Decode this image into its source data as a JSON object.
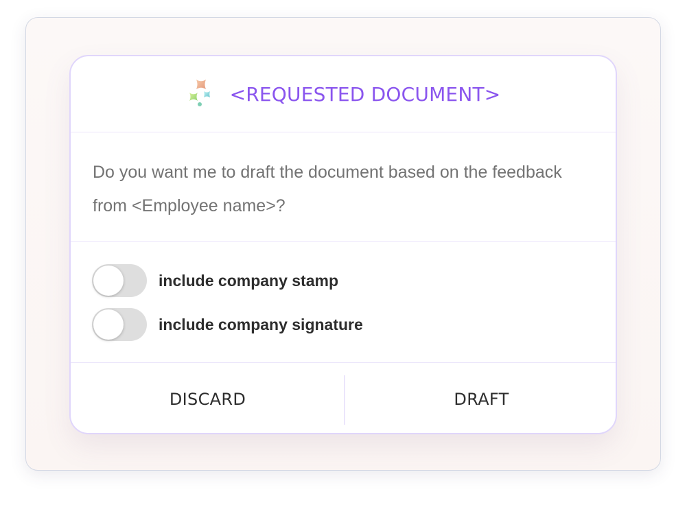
{
  "dialog": {
    "title": "<REQUESTED DOCUMENT>",
    "logo_icon": "sparkles-logo-icon",
    "message": "Do you want me to draft the document based on the feedback from <Employee name>?",
    "options": [
      {
        "label": "include company stamp",
        "enabled": false
      },
      {
        "label": "include company signature",
        "enabled": false
      }
    ],
    "actions": {
      "discard_label": "DISCARD",
      "draft_label": "DRAFT"
    }
  },
  "colors": {
    "accent": "#8a55ee",
    "toggle_off": "#dedede",
    "divider": "#ebe5fb",
    "dialog_border": "#e0d6fb"
  }
}
